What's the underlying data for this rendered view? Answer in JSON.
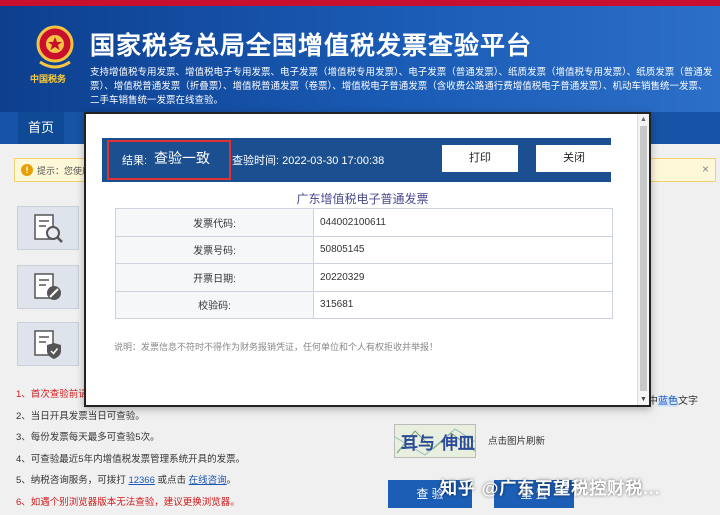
{
  "header": {
    "title": "国家税务总局全国增值税发票查验平台",
    "emblem_text": "中国税务",
    "description": "支持增值税专用发票、增值税电子专用发票、电子发票（增值税专用发票）、电子发票（普通发票）、纸质发票（增值税专用发票）、纸质发票（普通发票）、增值税普通发票（折叠票）、增值税普通发票（卷票）、增值税电子普通发票（含收费公路通行费增值税电子普通发票）、机动车销售统一发票、二手车销售统一发票在线查验。"
  },
  "nav": {
    "home": "首页"
  },
  "tip": {
    "icon": "!",
    "text": "提示：您使用",
    "close": "×"
  },
  "notes": {
    "n1": "1、首次查验前请",
    "n2": "2、当日开具发票当日可查验。",
    "n3": "3、每份发票每天最多可查验5次。",
    "n4": "4、可查验最近5年内增值税发票管理系统开具的发票。",
    "n5_pre": "5、纳税咨询服务，可拨打",
    "n5_phone": "12366",
    "n5_mid": "或点击",
    "n5_link": "在线咨询",
    "n5_end": "。",
    "n6": "6、如遇个别浏览器版本无法查验，建议更换浏览器。"
  },
  "captcha": {
    "hint": "点击图片刷新",
    "image_text": "耳与 伸皿"
  },
  "blue_hint": {
    "prefix": "中",
    "highlight": "蓝色",
    "suffix": "文字"
  },
  "buttons": {
    "query": "查 验",
    "reset": "重 置"
  },
  "watermark": "知乎 @广东百望税控财税...",
  "modal": {
    "result_label": "结果:",
    "result_value": "查验一致",
    "check_time": "查验时间: 2022-03-30 17:00:38",
    "print": "打印",
    "close": "关闭",
    "invoice_title": "广东增值税电子普通发票",
    "rows": [
      {
        "key": "发票代码:",
        "value": "044002100611"
      },
      {
        "key": "发票号码:",
        "value": "50805145"
      },
      {
        "key": "开票日期:",
        "value": "20220329"
      },
      {
        "key": "校验码:",
        "value": "315681"
      }
    ],
    "note": "说明：发票信息不符时不得作为财务报销凭证，任何单位和个人有权拒收并举报！"
  },
  "colors": {
    "header": "#1554a6",
    "result_bar": "#1c4f8f",
    "highlight_box": "#e0302f",
    "warning": "#d21a1a"
  }
}
